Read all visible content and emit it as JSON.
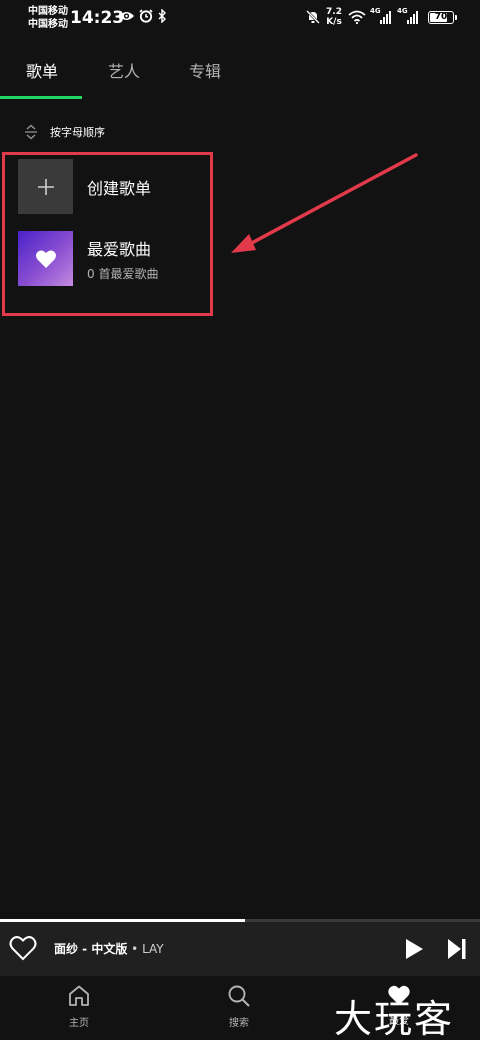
{
  "status_bar": {
    "carrier_1": "中国移动",
    "carrier_2": "中国移动",
    "time": "14:23",
    "net_speed_value": "7.2",
    "net_speed_unit": "K/s",
    "sim1_type": "4G",
    "sim2_type": "4G",
    "battery": "70"
  },
  "tabs": [
    {
      "label": "歌单"
    },
    {
      "label": "艺人"
    },
    {
      "label": "专辑"
    }
  ],
  "sort": {
    "label": "按字母顺序"
  },
  "library": {
    "items": [
      {
        "title": "创建歌单",
        "subtitle": ""
      },
      {
        "title": "最爱歌曲",
        "subtitle": "0 首最爱歌曲"
      }
    ]
  },
  "now_playing": {
    "title": "面纱 - 中文版",
    "separator": " • ",
    "artist": "LAY",
    "progress": 0.51
  },
  "bottom_nav": [
    {
      "label": "主页"
    },
    {
      "label": "搜索"
    },
    {
      "label": "最爱"
    }
  ],
  "watermark": "大玩客",
  "colors": {
    "background": "#121212",
    "accent": "#1ed760",
    "annotation": "#e23a4a"
  }
}
